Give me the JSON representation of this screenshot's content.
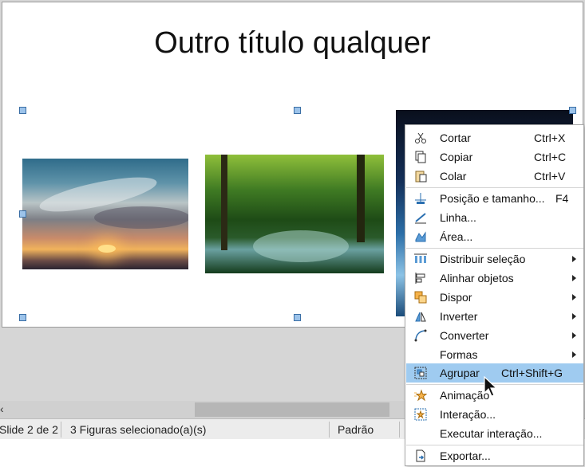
{
  "slide": {
    "title": "Outro título qualquer"
  },
  "status": {
    "slide_info": "Slide 2 de 2",
    "selection": "3 Figuras selecionado(a)(s)",
    "layout": "Padrão"
  },
  "scroll": {
    "arrow": "‹"
  },
  "menu": {
    "cut": {
      "label": "Cortar",
      "shortcut": "Ctrl+X",
      "icon": "scissors-icon"
    },
    "copy": {
      "label": "Copiar",
      "shortcut": "Ctrl+C",
      "icon": "copy-icon"
    },
    "paste": {
      "label": "Colar",
      "shortcut": "Ctrl+V",
      "icon": "paste-icon"
    },
    "position_size": {
      "label": "Posição e tamanho...",
      "shortcut": "F4",
      "icon": "position-size-icon"
    },
    "line": {
      "label": "Linha...",
      "icon": "line-icon"
    },
    "area": {
      "label": "Área...",
      "icon": "area-icon"
    },
    "distribute": {
      "label": "Distribuir seleção",
      "icon": "distribute-icon"
    },
    "align": {
      "label": "Alinhar objetos",
      "icon": "align-icon"
    },
    "arrange": {
      "label": "Dispor",
      "icon": "arrange-icon"
    },
    "flip": {
      "label": "Inverter",
      "icon": "flip-icon"
    },
    "convert": {
      "label": "Converter",
      "icon": "convert-icon"
    },
    "shapes": {
      "label": "Formas"
    },
    "group": {
      "label": "Agrupar",
      "shortcut": "Ctrl+Shift+G",
      "icon": "group-icon"
    },
    "animation": {
      "label": "Animação",
      "icon": "animation-icon"
    },
    "interaction": {
      "label": "Interação...",
      "icon": "interaction-icon"
    },
    "run_interaction": {
      "label": "Executar interação..."
    },
    "export": {
      "label": "Exportar...",
      "icon": "export-icon"
    }
  },
  "colors": {
    "highlight": "#9fcbf0",
    "handle": "#9cc3ea"
  }
}
